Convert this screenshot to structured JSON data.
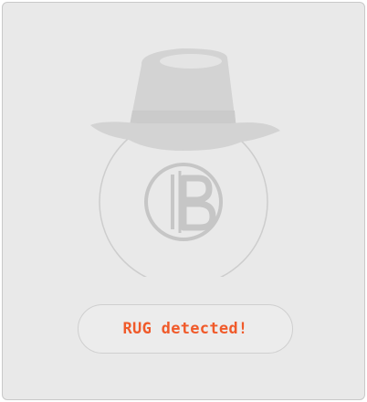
{
  "status": {
    "message": "RUG detected!",
    "color": "#f05a2a"
  },
  "illustration": {
    "icons": [
      "detective-hat-icon",
      "bitcoin-coin-icon"
    ],
    "hat_color": "#d3d3d3",
    "coin_color": "#c8c8c8"
  }
}
